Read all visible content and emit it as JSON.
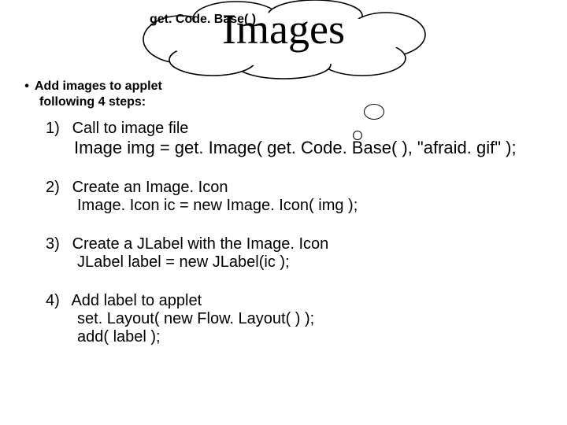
{
  "title": "Images",
  "title_inline": "get. Code. Base( )",
  "intro": {
    "line1": "Add images to applet",
    "line2": "following 4 steps:"
  },
  "steps": [
    {
      "num": "1)",
      "head": "Call to image file",
      "body": "Image img = get. Image( get. Code. Base( ), \"afraid. gif\" );"
    },
    {
      "num": "2)",
      "head": "Create an Image. Icon",
      "body": "Image. Icon ic = new Image. Icon( img );"
    },
    {
      "num": "3)",
      "head": "Create a JLabel with the Image. Icon",
      "body": " JLabel label = new JLabel(ic );"
    },
    {
      "num": "4)",
      "head": "Add label to applet",
      "body": "set. Layout( new Flow. Layout( ) );\nadd( label );"
    }
  ]
}
